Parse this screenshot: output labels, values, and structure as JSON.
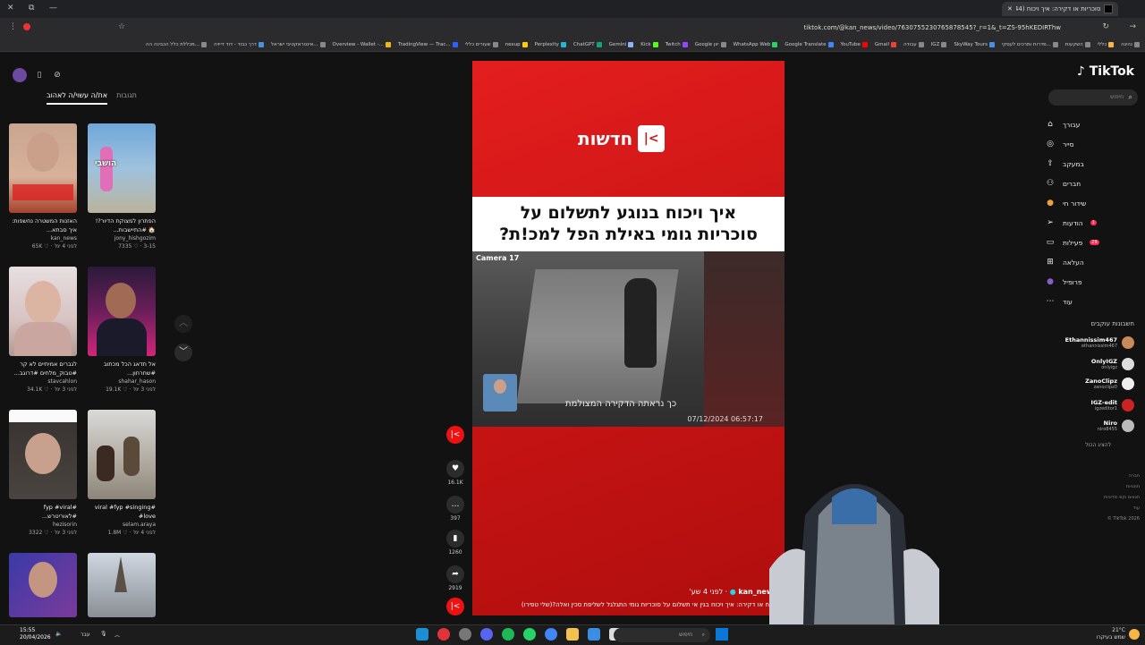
{
  "browser": {
    "tab_title": "סוכריות או דקירה: איך ויכוח (44)",
    "url": "tiktok.com/@kan_news/video/7630755230765878545?_r=1&_t=ZS-95hKEDIRThw",
    "bookmarks": [
      "נהיגה",
      "כללי",
      "השקעות",
      "פדרות ומרכים לעסקי...",
      "SkyWay Tours",
      "IGZ",
      "עבודה",
      "Gmail",
      "YouTube",
      "Google Translate",
      "WhatsApp Web",
      "Google יוון",
      "Twitch",
      "Kick",
      "Gemini",
      "ChatGPT",
      "Perplexity",
      "nexup",
      "שעורים כללי",
      "TradingView — Trac...",
      "Overview - Wallet -...",
      "אינטראקטיבי ישראל...",
      "דרך כבוד - דוד דייויה",
      "מכללת כלל הכבינה הה..."
    ]
  },
  "left_panel": {
    "tabs": [
      "תגובות",
      "את/ה עשוי/ה לאהוב"
    ],
    "videos": [
      {
        "title": "האזנות המשטרה נחשפות: איך סבתא...",
        "author": "kan_news",
        "likes": "65K",
        "age": "לפני 4 ימ'"
      },
      {
        "title": "הפתרון למצוקת הדיור?! 🏠 #התיישבות...",
        "author": "jony_hishgozim",
        "likes": "7335",
        "age": "3-15"
      },
      {
        "title": "לגברים אמיתיים לא קר #טבוק_מלחים #דרוגב...",
        "author": "stavcahlon",
        "likes": "34.1K",
        "age": "לפני 3 ימ'"
      },
      {
        "title": "אל תדאג הכל מכתוב #שחרחון...",
        "author": "shahar_hason",
        "likes": "19.1K",
        "age": "לפני 3 ימ'"
      },
      {
        "title": "#fyp #viral #לאוריטרש...",
        "author": "hezisorin",
        "likes": "3322",
        "age": "לפני 3 ימ'"
      },
      {
        "title": "#viral #fyp #singing #love",
        "author": "selam.araya",
        "likes": "1.8M",
        "age": "לפני 4 ימ'"
      }
    ]
  },
  "video": {
    "brand": "חדשות",
    "headline_line1": "איך ויכוח בנוגע לתשלום על",
    "headline_line2": "סוכריות גומי באילת הפל למכ!ת?",
    "camera_label": "Camera 17",
    "cam_timestamp": "07/12/2024 06:57:17",
    "cam_subtitle": "כך נראתה הדקירה המצולמת",
    "author": "kan_news",
    "age": "לפני 4 שע'",
    "description": "ויכוח או דקירה: איך ויכוח בגין אי תשלום על סוכריות גומי התגלגל לשליפת סכין ואלה?(שלי טפירו)"
  },
  "actions": {
    "likes": "16.1K",
    "comments": "397",
    "saves": "1260",
    "shares": "2919"
  },
  "right_panel": {
    "brand": "TikTok",
    "search_placeholder": "חיפוש",
    "menu": [
      "עבורך",
      "סייר",
      "במעקב",
      "חברים",
      "שידור חי",
      "הודעות",
      "פעילות",
      "העלאה",
      "פרופיל",
      "עוד"
    ],
    "notif_badge_messages": "1",
    "notif_badge_activity": "29",
    "following_header": "חשבונות עוקבים",
    "following": [
      {
        "name": "Ethannissim467",
        "handle": "ethannissim467"
      },
      {
        "name": "OnlyIGZ",
        "handle": "onlyigz"
      },
      {
        "name": "ZanoClipz",
        "handle": "zanoclipz0"
      },
      {
        "name": "IGZ-edit",
        "handle": "igzeditor1"
      },
      {
        "name": "Niro",
        "handle": "niro8455"
      }
    ],
    "show_all": "להציג הכול",
    "footer": [
      "חברה",
      "תוכניות",
      "תנאים וקווי מדיניות",
      "עוד",
      "TikTok 2026 ©"
    ]
  },
  "taskbar": {
    "time": "15:55",
    "date": "20/04/2026",
    "lang": "עבר",
    "search_placeholder": "חיפוש",
    "weather_temp": "21°C",
    "weather_desc": "שמש בעיקרו"
  }
}
